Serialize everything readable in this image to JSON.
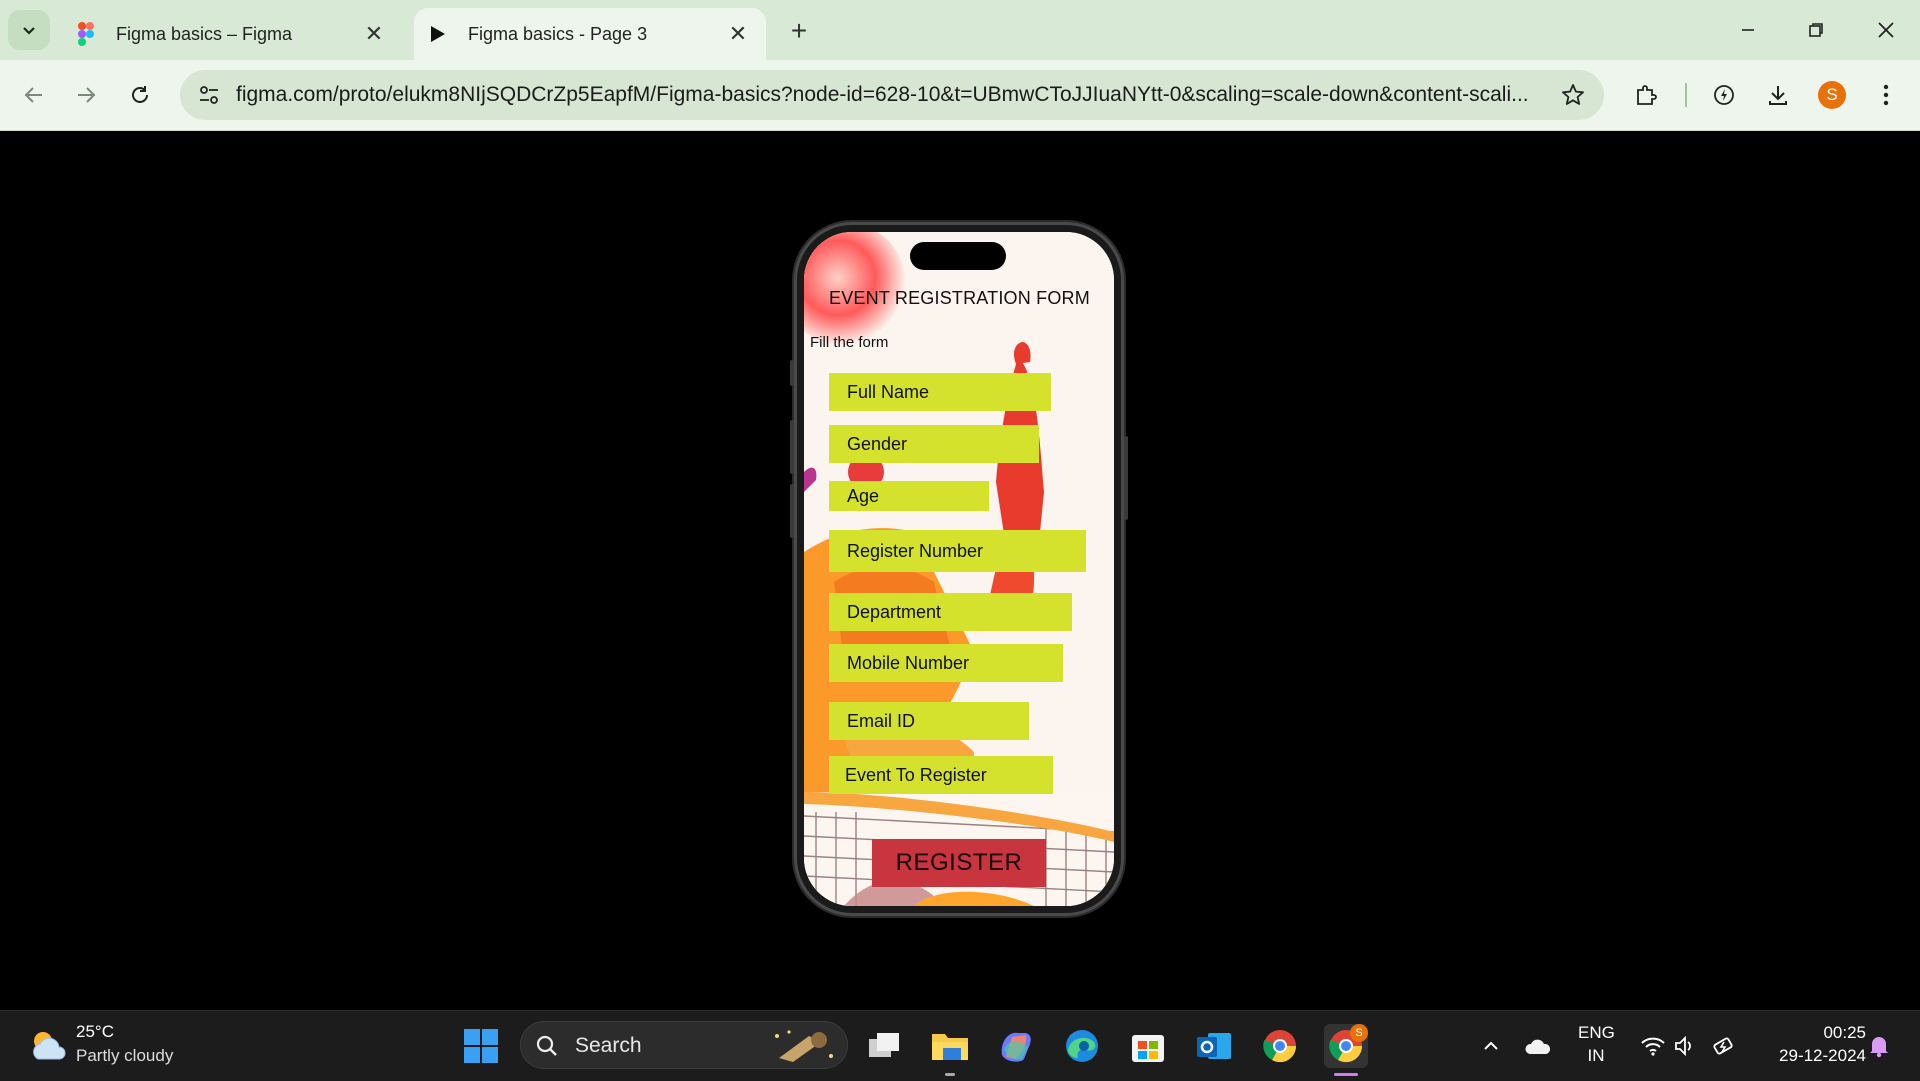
{
  "browser": {
    "tabs": [
      {
        "title": "Figma basics – Figma",
        "active": false,
        "icon": "figma-logo-icon"
      },
      {
        "title": "Figma basics - Page 3",
        "active": true,
        "icon": "play-icon"
      }
    ],
    "url": "figma.com/proto/elukm8NIjSQDCrZp5EapfM/Figma-basics?node-id=628-10&t=UBmwCToJJIuaNYtt-0&scaling=scale-down&content-scali...",
    "profile_initial": "S"
  },
  "form": {
    "title": "EVENT REGISTRATION FORM",
    "subtitle": "Fill the form",
    "fields": [
      "Full Name",
      "Gender",
      "Age",
      "Register Number",
      "Department",
      "Mobile Number",
      "Email ID",
      "Event To Register"
    ],
    "submit_label": "REGISTER",
    "colors": {
      "field": "#d4e22e",
      "button": "#c8353e"
    }
  },
  "taskbar": {
    "weather_temp": "25°C",
    "weather_desc": "Partly cloudy",
    "search_label": "Search",
    "language_line1": "ENG",
    "language_line2": "IN",
    "time": "00:25",
    "date": "29-12-2024",
    "chrome_badge": "S",
    "apps": [
      "start",
      "search",
      "task-view",
      "file-explorer",
      "copilot",
      "edge",
      "microsoft-store",
      "outlook",
      "chrome",
      "chrome-profile"
    ]
  }
}
